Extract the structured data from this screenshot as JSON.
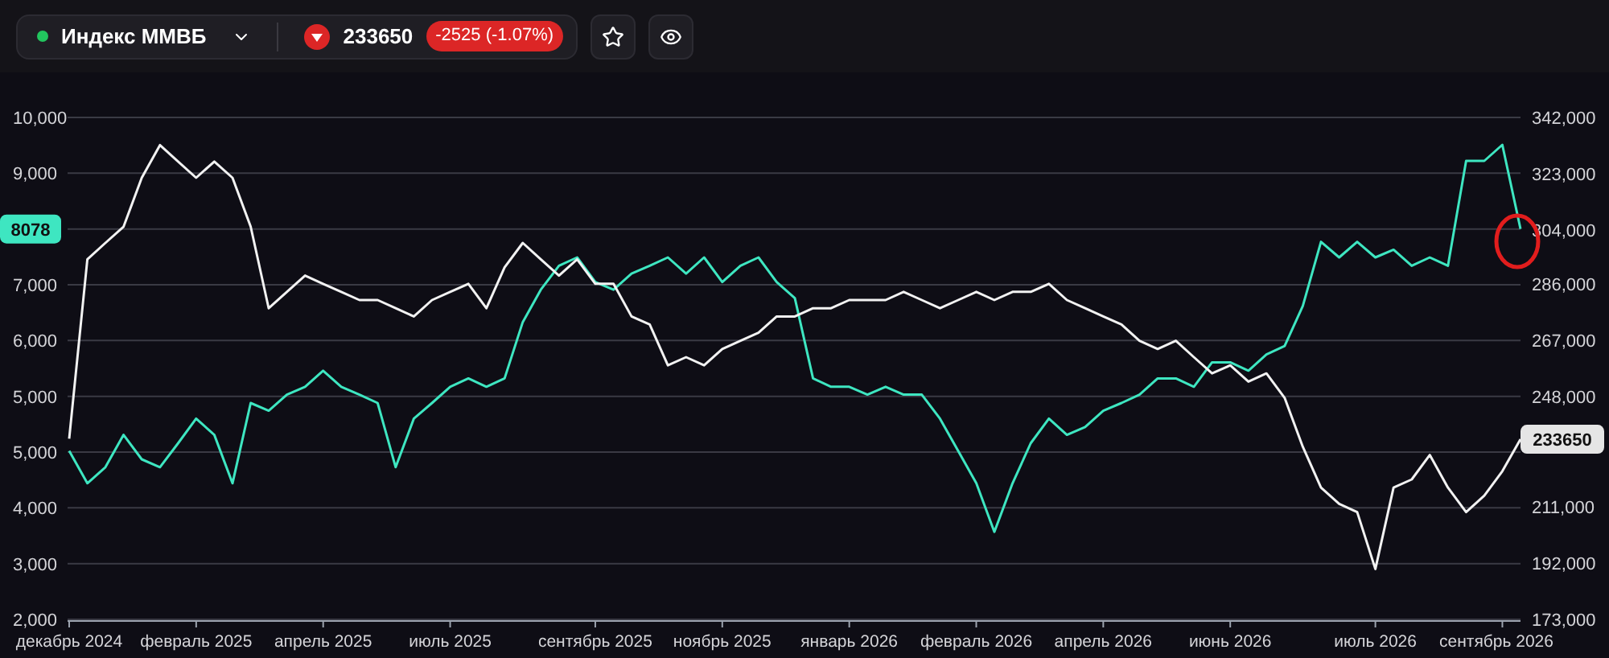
{
  "header": {
    "instrument": {
      "name": "Индекс ММВБ",
      "online": true
    },
    "falling": true,
    "price": "233650",
    "change": "-2525 (-1.07%)",
    "actions": [
      {
        "kind": "favorite"
      },
      {
        "kind": "watch"
      }
    ]
  },
  "chart": {
    "price_labels": [
      {
        "kind": "left",
        "label": "8078"
      },
      {
        "kind": "right",
        "label": "233650"
      }
    ],
    "lower_left_labels": [
      "5,000",
      "4,000",
      "3,000",
      "2,000"
    ],
    "highlight": true,
    "chart_data": {
      "type": "line",
      "grid": true,
      "categories": [
        "декабрь 2024",
        null,
        null,
        null,
        null,
        null,
        null,
        "февраль 2025",
        null,
        null,
        null,
        null,
        null,
        null,
        "апрель 2025",
        null,
        null,
        null,
        null,
        null,
        null,
        "июль 2025",
        null,
        null,
        null,
        null,
        null,
        null,
        null,
        "сентябрь 2025",
        null,
        null,
        null,
        null,
        null,
        null,
        "ноябрь 2025",
        null,
        null,
        null,
        null,
        null,
        null,
        "январь 2026",
        null,
        null,
        null,
        null,
        null,
        null,
        "февраль 2026",
        null,
        null,
        null,
        null,
        null,
        null,
        "апрель 2026",
        null,
        null,
        null,
        null,
        null,
        null,
        "июнь 2026",
        null,
        null,
        null,
        null,
        null,
        null,
        null,
        "июль 2026",
        null,
        null,
        null,
        null,
        null,
        null,
        "сентябрь 2026",
        null
      ],
      "ylim": [
        1000,
        10000
      ],
      "yticks": [
        {
          "value": 10000,
          "label": "10,000"
        },
        {
          "value": 9000,
          "label": "9,000"
        },
        {
          "value": 7000,
          "label": "7,000"
        },
        {
          "value": 6000,
          "label": "6,000"
        },
        {
          "value": 5000,
          "label": "5,000"
        }
      ],
      "y2lim": [
        173000,
        342000
      ],
      "y2ticks": [
        {
          "value": 342000,
          "label": "342,000"
        },
        {
          "value": 323000,
          "label": "323,000"
        },
        {
          "value": 304000,
          "label": "304,000"
        },
        {
          "value": 286000,
          "label": "286,000"
        },
        {
          "value": 267000,
          "label": "267,000"
        },
        {
          "value": 248000,
          "label": "248,000"
        },
        {
          "value": 211000,
          "label": "211,000"
        },
        {
          "value": 192000,
          "label": "192,000"
        },
        {
          "value": 173000,
          "label": "173,000"
        }
      ],
      "series": [
        {
          "color": "#3ee6c1",
          "values": [
            4020,
            3440,
            3730,
            4310,
            3870,
            3730,
            4160,
            4600,
            4310,
            3440,
            4880,
            4740,
            5030,
            5170,
            5460,
            5170,
            5030,
            4880,
            3730,
            4600,
            4880,
            5170,
            5320,
            5170,
            5320,
            6330,
            6910,
            7340,
            7490,
            7050,
            6910,
            7200,
            7340,
            7490,
            7200,
            7490,
            7050,
            7340,
            7490,
            7050,
            6760,
            5320,
            5170,
            5170,
            5030,
            5170,
            5030,
            5030,
            4600,
            4020,
            3440,
            2570,
            3440,
            4160,
            4600,
            4310,
            4450,
            4740,
            4880,
            5030,
            5320,
            5320,
            5170,
            5610,
            5610,
            5460,
            5750,
            5900,
            6620,
            7770,
            7490,
            7770,
            7490,
            7630,
            7340,
            7490,
            7340,
            9220,
            9220,
            9510,
            8000
          ]
        },
        {
          "color": "#f2f2f2",
          "axis": "y2",
          "values": [
            233850,
            294240,
            299730,
            305220,
            321690,
            332670,
            327180,
            321690,
            327180,
            321690,
            305220,
            277770,
            283260,
            288750,
            286000,
            283260,
            280510,
            280510,
            277770,
            275020,
            280510,
            283260,
            286000,
            277770,
            291490,
            299730,
            294240,
            288750,
            294240,
            286000,
            286000,
            275020,
            272280,
            258550,
            261300,
            258550,
            264040,
            266790,
            269530,
            275020,
            275020,
            277770,
            277770,
            280510,
            280510,
            280510,
            283260,
            280510,
            277770,
            280510,
            283260,
            280510,
            283260,
            283260,
            286000,
            280510,
            277770,
            275020,
            272280,
            266790,
            264040,
            266790,
            261300,
            255810,
            258550,
            253060,
            255810,
            247570,
            231100,
            217380,
            211890,
            209140,
            189930,
            217380,
            220120,
            228360,
            217380,
            209140,
            214630,
            222870,
            233650
          ]
        }
      ]
    }
  }
}
